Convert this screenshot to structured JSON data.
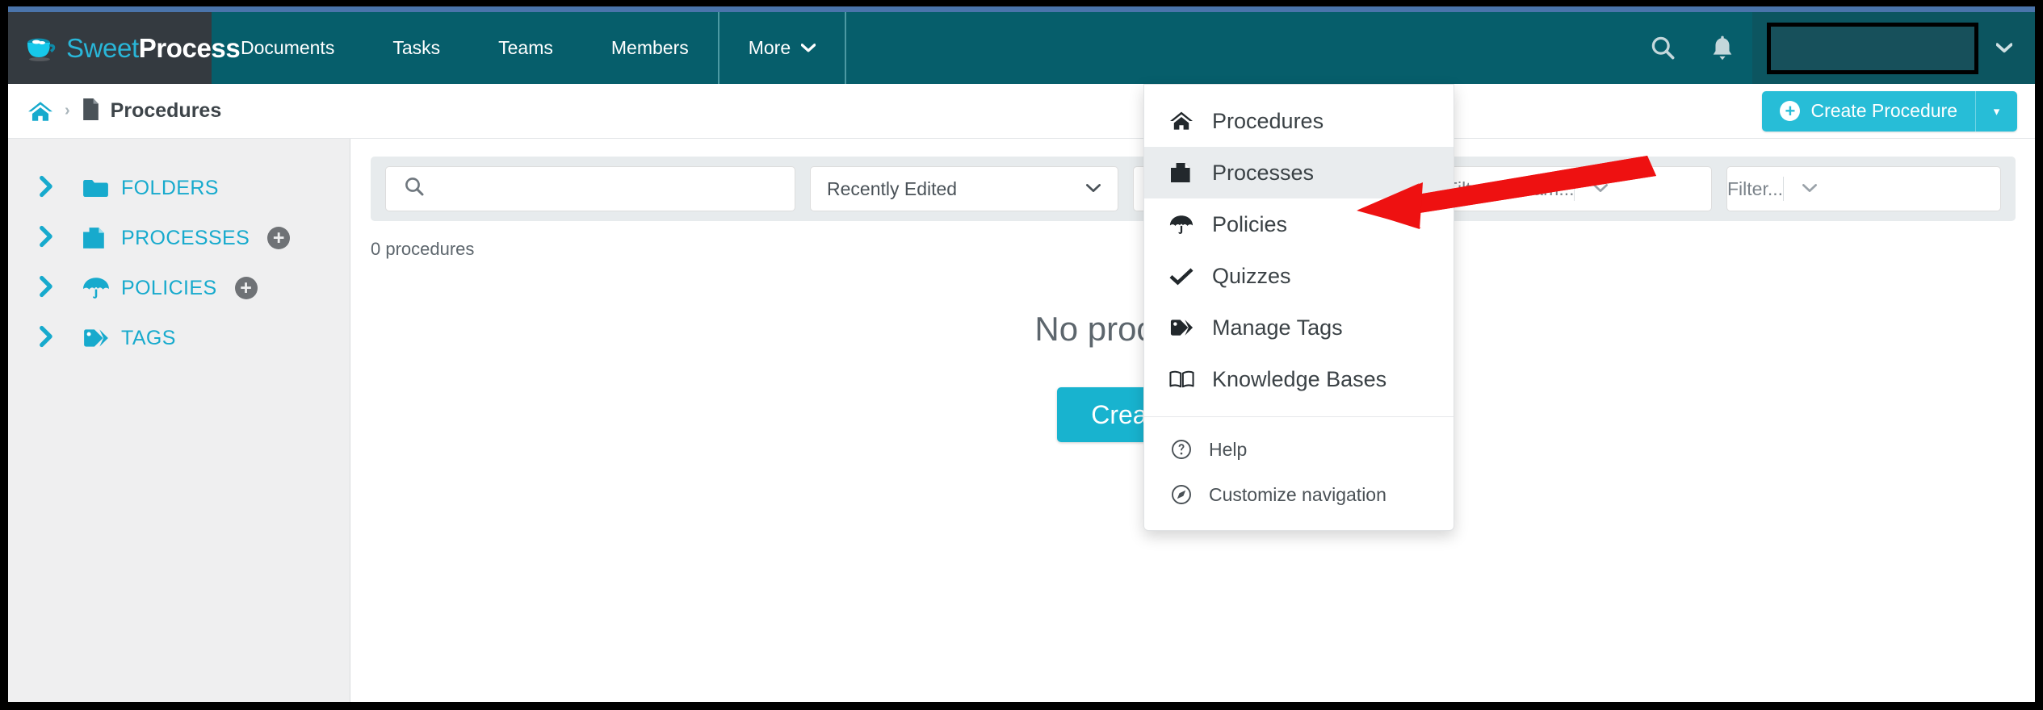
{
  "brand": {
    "part1": "Sweet",
    "part2": "Process",
    "logo_icon": "coffee-cup-icon"
  },
  "topnav": {
    "items": [
      {
        "label": "Documents",
        "name": "documents"
      },
      {
        "label": "Tasks",
        "name": "tasks"
      },
      {
        "label": "Teams",
        "name": "teams"
      },
      {
        "label": "Members",
        "name": "members"
      },
      {
        "label": "More",
        "name": "more",
        "caret": "❯",
        "open": true
      }
    ],
    "search_icon": "search-icon",
    "bell_icon": "bell-icon",
    "user_caret": "❯",
    "bg_color": "#065e6b",
    "brand_bg_color": "#343a40"
  },
  "breadcrumb": {
    "home_icon": "home-icon",
    "separator": "›",
    "doc_icon": "document-icon",
    "label": "Procedures"
  },
  "create_button": {
    "plus": "+",
    "label": "Create Procedure",
    "caret": "▾",
    "color": "#27bdd7"
  },
  "sidebar": {
    "items": [
      {
        "chevron": "❯",
        "icon": "folder-icon",
        "label": "FOLDERS",
        "add": false
      },
      {
        "chevron": "❯",
        "icon": "processes-icon",
        "label": "PROCESSES",
        "add": true,
        "add_label": "+"
      },
      {
        "chevron": "❯",
        "icon": "umbrella-icon",
        "label": "POLICIES",
        "add": true,
        "add_label": "+"
      },
      {
        "chevron": "❯",
        "icon": "tag-icon",
        "label": "TAGS",
        "add": false
      }
    ],
    "accent_color": "#17aacd",
    "bg_color": "#efeff0"
  },
  "toolbar": {
    "search": {
      "icon": "search-icon",
      "value": "",
      "placeholder": ""
    },
    "sort": {
      "value": "Recently Edited",
      "caret": "⌄"
    },
    "filter_tag": {
      "placeholder": "Filter...",
      "caret": "⌄"
    },
    "filter_team": {
      "placeholder": "Filter by team...",
      "caret": "⌄"
    },
    "filter_last": {
      "placeholder": "Filter...",
      "caret": "⌄"
    }
  },
  "main": {
    "count_text": "0 procedures",
    "empty_title": "No procedures found",
    "empty_button": "Create Procedure"
  },
  "dropdown": {
    "items": [
      {
        "icon": "home-icon",
        "label": "Procedures",
        "active": false
      },
      {
        "icon": "processes-icon",
        "label": "Processes",
        "active": true
      },
      {
        "icon": "umbrella-icon",
        "label": "Policies",
        "active": false
      },
      {
        "icon": "check-icon",
        "label": "Quizzes",
        "active": false
      },
      {
        "icon": "tag-icon",
        "label": "Manage Tags",
        "active": false
      },
      {
        "icon": "book-icon",
        "label": "Knowledge Bases",
        "active": false
      }
    ],
    "footer_items": [
      {
        "icon": "question-circle-icon",
        "label": "Help"
      },
      {
        "icon": "compass-icon",
        "label": "Customize navigation"
      }
    ]
  },
  "annotation": {
    "arrow_color": "#ee1111",
    "arrow_target": "Processes"
  }
}
